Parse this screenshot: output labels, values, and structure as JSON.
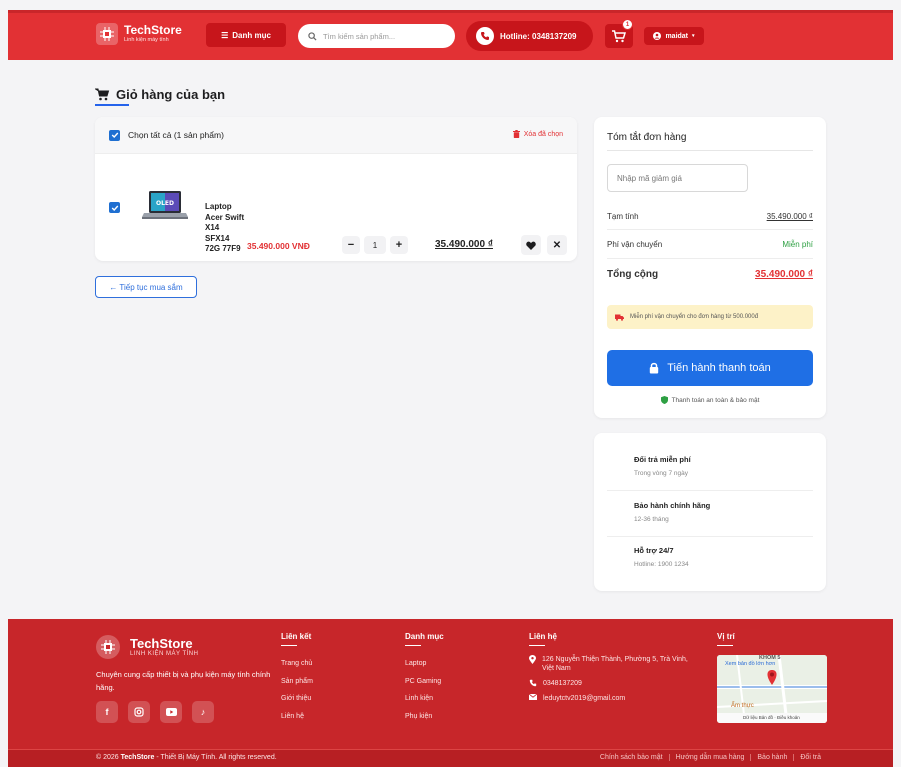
{
  "header": {
    "brand": "TechStore",
    "brand_sub": "Linh kiện máy tính",
    "menu_label": "Danh mục",
    "search_placeholder": "Tìm kiếm sản phẩm...",
    "hotline": "Hotline: 0348137209",
    "cart_count": "1",
    "username": "maidat"
  },
  "cart": {
    "page_title": "Giỏ hàng của bạn",
    "select_all": "Chọn tất cả (1 sản phẩm)",
    "delete_selected": "Xóa đã chọn",
    "items": [
      {
        "name": "Laptop Acer Swift X14 SFX14 72G 77F9",
        "price": "35.490.000 VNĐ",
        "quantity": "1",
        "total": "35.490.000 ₫"
      }
    ],
    "continue_shopping": "← Tiếp tục mua sắm"
  },
  "summary": {
    "title": "Tóm tắt đơn hàng",
    "coupon_placeholder": "Nhập mã giảm giá",
    "subtotal_label": "Tạm tính",
    "subtotal_value": "35.490.000 ₫",
    "shipping_label": "Phí vận chuyển",
    "shipping_value": "Miễn phí",
    "total_label": "Tổng cộng",
    "total_value": "35.490.000 ₫",
    "notice": "Miễn phí vận chuyển cho đơn hàng từ 500.000đ",
    "checkout_label": "Tiến hành thanh toán",
    "secure_label": "Thanh toán an toàn & bảo mật"
  },
  "benefits": [
    {
      "title": "Đổi trả miễn phí",
      "sub": "Trong vòng 7 ngày"
    },
    {
      "title": "Bảo hành chính hãng",
      "sub": "12-36 tháng"
    },
    {
      "title": "Hỗ trợ 24/7",
      "sub": "Hotline: 1900 1234"
    }
  ],
  "footer": {
    "brand": "TechStore",
    "brand_sub": "LINH KIỆN MÁY TÍNH",
    "description": "Chuyên cung cấp thiết bị và phụ kiện máy tính chính hãng.",
    "links_title": "Liên kết",
    "links": [
      "Trang chủ",
      "Sản phẩm",
      "Giới thiệu",
      "Liên hệ"
    ],
    "categories_title": "Danh mục",
    "categories": [
      "Laptop",
      "PC Gaming",
      "Linh kiện",
      "Phụ kiện"
    ],
    "contact_title": "Liên hệ",
    "address": "126 Nguyễn Thiện Thành, Phường 5, Trà Vinh, Việt Nam",
    "phone": "0348137209",
    "email": "leduytctv2019@gmail.com",
    "location_title": "Vị trí",
    "map_link": "Xem bản đồ lớn hơn",
    "map_label_area": "KHÓM 5",
    "map_label_place": "Ẩm thực",
    "map_footer": "Dữ liệu Bản đồ · Điều khoản",
    "copyright_prefix": "© 2026",
    "copyright_brand": "TechStore",
    "copyright_suffix": "- Thiết Bị Máy Tính. All rights reserved.",
    "bottom_links": [
      "Chính sách bảo mật",
      "Hướng dẫn mua hàng",
      "Bảo hành",
      "Đổi trả"
    ]
  },
  "colors": {
    "brand_red": "#e23134",
    "primary_blue": "#1f6fe5",
    "success_green": "#2ea043"
  }
}
